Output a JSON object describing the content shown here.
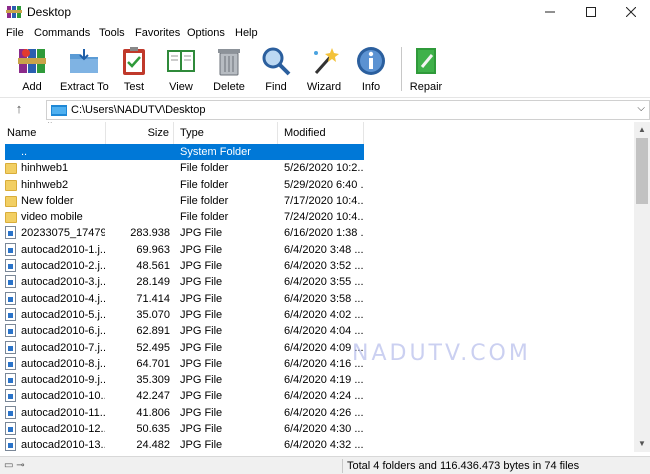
{
  "window": {
    "title": "Desktop"
  },
  "menu": [
    "File",
    "Commands",
    "Tools",
    "Favorites",
    "Options",
    "Help"
  ],
  "toolbar": [
    {
      "label": "Add",
      "icon": "add-books-icon"
    },
    {
      "label": "Extract To",
      "icon": "extract-folder-icon"
    },
    {
      "label": "Test",
      "icon": "test-clipboard-icon"
    },
    {
      "label": "View",
      "icon": "view-book-icon"
    },
    {
      "label": "Delete",
      "icon": "trash-icon"
    },
    {
      "label": "Find",
      "icon": "magnifier-icon"
    },
    {
      "label": "Wizard",
      "icon": "magic-wand-icon"
    },
    {
      "label": "Info",
      "icon": "info-icon"
    },
    {
      "label": "Repair",
      "icon": "repair-book-icon"
    }
  ],
  "address": {
    "path": "C:\\Users\\NADUTV\\Desktop"
  },
  "columns": {
    "name": "Name",
    "size": "Size",
    "type": "Type",
    "modified": "Modified"
  },
  "rows": [
    {
      "name": "..",
      "size": "",
      "type": "System Folder",
      "modified": "",
      "kind": "up",
      "selected": true
    },
    {
      "name": "hinhweb1",
      "size": "",
      "type": "File folder",
      "modified": "5/26/2020 10:2...",
      "kind": "folder"
    },
    {
      "name": "hinhweb2",
      "size": "",
      "type": "File folder",
      "modified": "5/29/2020 6:40 ...",
      "kind": "folder"
    },
    {
      "name": "New folder",
      "size": "",
      "type": "File folder",
      "modified": "7/17/2020 10:4...",
      "kind": "folder"
    },
    {
      "name": "video mobile",
      "size": "",
      "type": "File folder",
      "modified": "7/24/2020 10:4...",
      "kind": "folder"
    },
    {
      "name": "20233075_17479...",
      "size": "283.938",
      "type": "JPG File",
      "modified": "6/16/2020 1:38 ...",
      "kind": "jpg"
    },
    {
      "name": "autocad2010-1.j...",
      "size": "69.963",
      "type": "JPG File",
      "modified": "6/4/2020 3:48 ...",
      "kind": "jpg"
    },
    {
      "name": "autocad2010-2.j...",
      "size": "48.561",
      "type": "JPG File",
      "modified": "6/4/2020 3:52 ...",
      "kind": "jpg"
    },
    {
      "name": "autocad2010-3.j...",
      "size": "28.149",
      "type": "JPG File",
      "modified": "6/4/2020 3:55 ...",
      "kind": "jpg"
    },
    {
      "name": "autocad2010-4.j...",
      "size": "71.414",
      "type": "JPG File",
      "modified": "6/4/2020 3:58 ...",
      "kind": "jpg"
    },
    {
      "name": "autocad2010-5.j...",
      "size": "35.070",
      "type": "JPG File",
      "modified": "6/4/2020 4:02 ...",
      "kind": "jpg"
    },
    {
      "name": "autocad2010-6.j...",
      "size": "62.891",
      "type": "JPG File",
      "modified": "6/4/2020 4:04 ...",
      "kind": "jpg"
    },
    {
      "name": "autocad2010-7.j...",
      "size": "52.495",
      "type": "JPG File",
      "modified": "6/4/2020 4:09 ...",
      "kind": "jpg"
    },
    {
      "name": "autocad2010-8.j...",
      "size": "64.701",
      "type": "JPG File",
      "modified": "6/4/2020 4:16 ...",
      "kind": "jpg"
    },
    {
      "name": "autocad2010-9.j...",
      "size": "35.309",
      "type": "JPG File",
      "modified": "6/4/2020 4:19 ...",
      "kind": "jpg"
    },
    {
      "name": "autocad2010-10....",
      "size": "42.247",
      "type": "JPG File",
      "modified": "6/4/2020 4:24 ...",
      "kind": "jpg"
    },
    {
      "name": "autocad2010-11....",
      "size": "41.806",
      "type": "JPG File",
      "modified": "6/4/2020 4:26 ...",
      "kind": "jpg"
    },
    {
      "name": "autocad2010-12....",
      "size": "50.635",
      "type": "JPG File",
      "modified": "6/4/2020 4:30 ...",
      "kind": "jpg"
    },
    {
      "name": "autocad2010-13....",
      "size": "24.482",
      "type": "JPG File",
      "modified": "6/4/2020 4:32 ...",
      "kind": "jpg"
    }
  ],
  "status": {
    "text": "Total 4 folders and 116.436.473 bytes in 74 files"
  },
  "watermark": "NADUTV.COM",
  "colors": {
    "selection": "#0078d7",
    "folder": "#f2cf63"
  }
}
